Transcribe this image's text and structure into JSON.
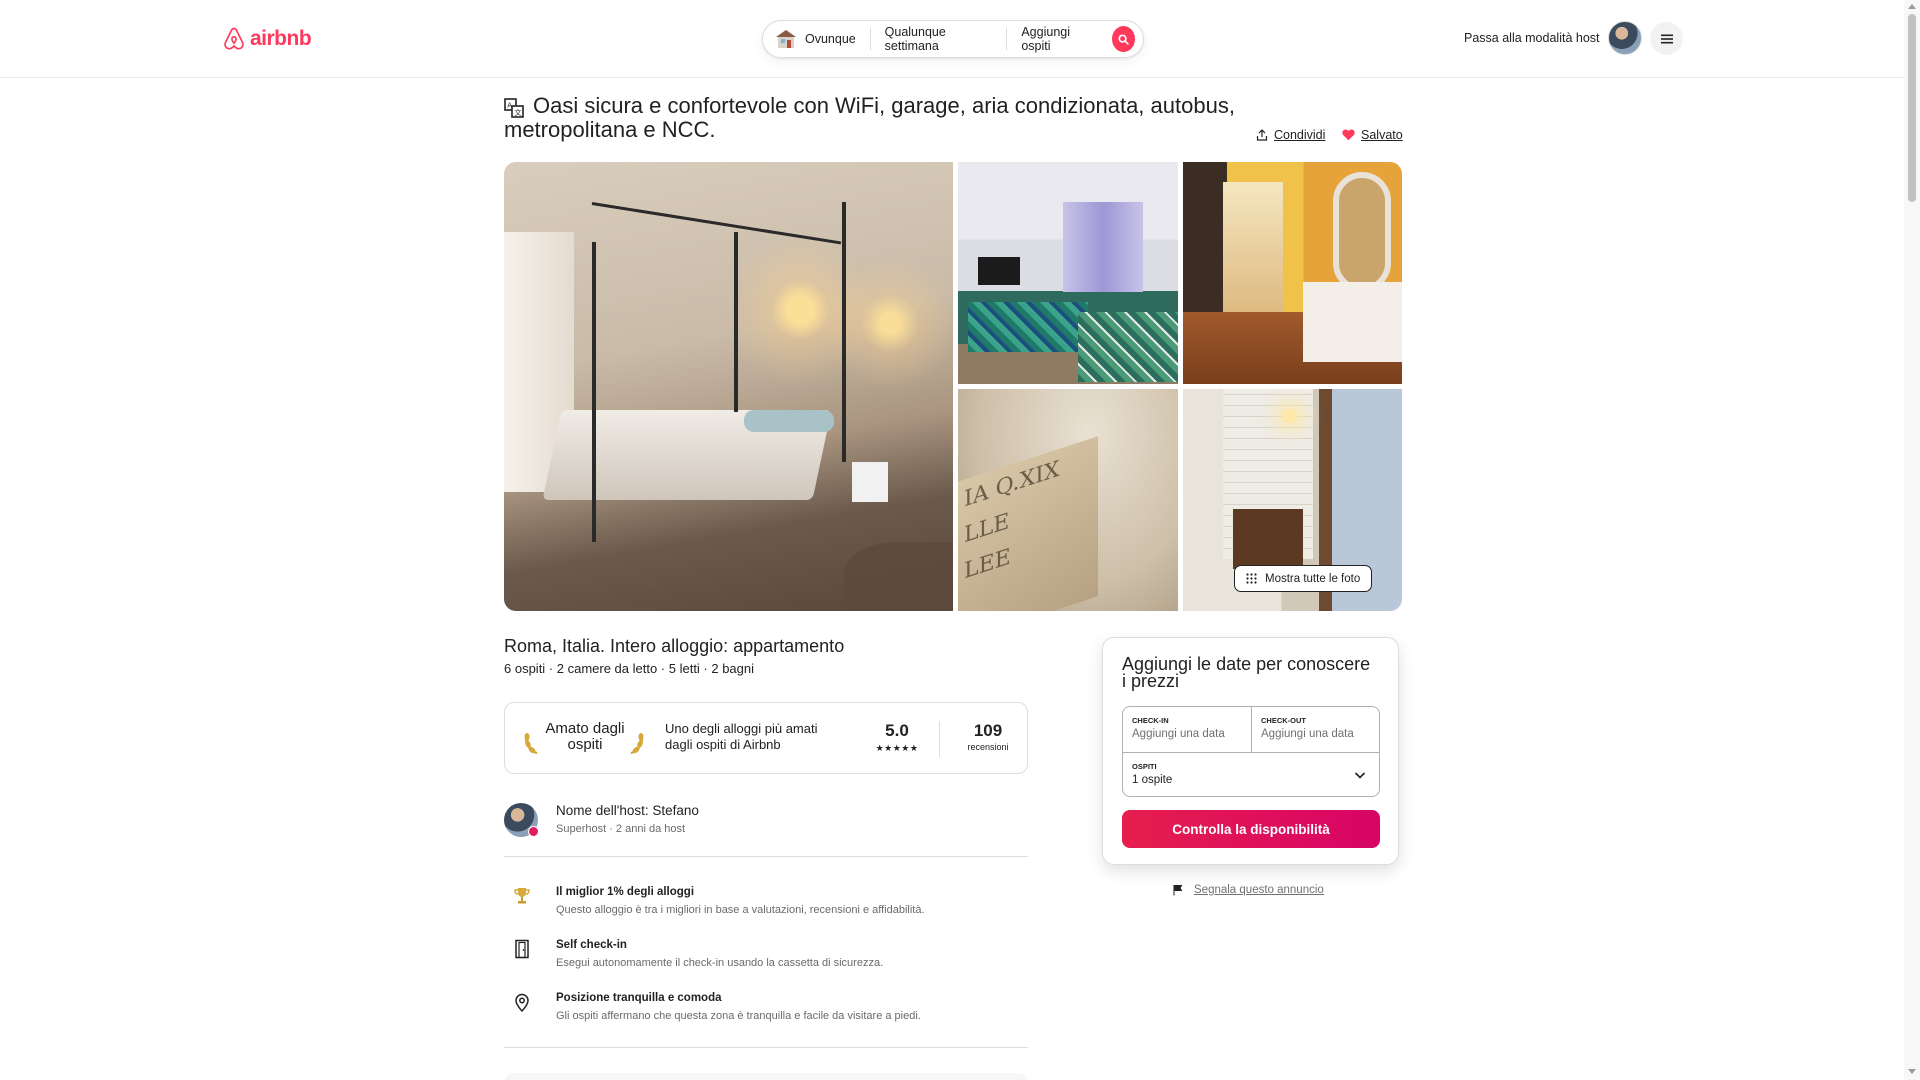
{
  "header": {
    "logo_text": "airbnb",
    "search": {
      "where": "Ovunque",
      "when": "Qualunque settimana",
      "who": "Aggiungi ospiti"
    },
    "host_mode": "Passa alla modalità host"
  },
  "listing": {
    "title": "Oasi sicura e confortevole con WiFi, garage, aria condizionata, autobus, metropolitana e NCC.",
    "share": "Condividi",
    "saved": "Salvato",
    "show_all_photos": "Mostra tutte le foto",
    "photo_inscription": "IA Q.XIX LLE LLE",
    "location_title": "Roma, Italia. Intero alloggio: appartamento",
    "summary": "6 ospiti · 2 camere da letto · 5 letti · 2 bagni"
  },
  "guest_favorite": {
    "badge": "Amato dagli ospiti",
    "description": "Uno degli alloggi più amati dagli ospiti di Airbnb",
    "rating": "5.0",
    "stars": "★★★★★",
    "reviews_count": "109",
    "reviews_label": "recensioni"
  },
  "host": {
    "name_line": "Nome dell'host: Stefano",
    "meta": "Superhost · 2 anni da host"
  },
  "features": [
    {
      "icon": "trophy-icon",
      "title": "Il miglior 1% degli alloggi",
      "desc": "Questo alloggio è tra i migliori in base a valutazioni, recensioni e affidabilità."
    },
    {
      "icon": "door-icon",
      "title": "Self check-in",
      "desc": "Esegui autonomamente il check-in usando la cassetta di sicurezza."
    },
    {
      "icon": "map-pin-icon",
      "title": "Posizione tranquilla e comoda",
      "desc": "Gli ospiti affermano che questa zona è tranquilla e facile da visitare a piedi."
    }
  ],
  "booking": {
    "heading": "Aggiungi le date per conoscere i prezzi",
    "checkin_label": "CHECK-IN",
    "checkin_value": "Aggiungi una data",
    "checkout_label": "CHECK-OUT",
    "checkout_value": "Aggiungi una data",
    "guests_label": "OSPITI",
    "guests_value": "1 ospite",
    "cta": "Controlla la disponibilità",
    "report": "Segnala questo annuncio"
  },
  "colors": {
    "brand": "#ff385c",
    "cta": "#e61e4d"
  }
}
